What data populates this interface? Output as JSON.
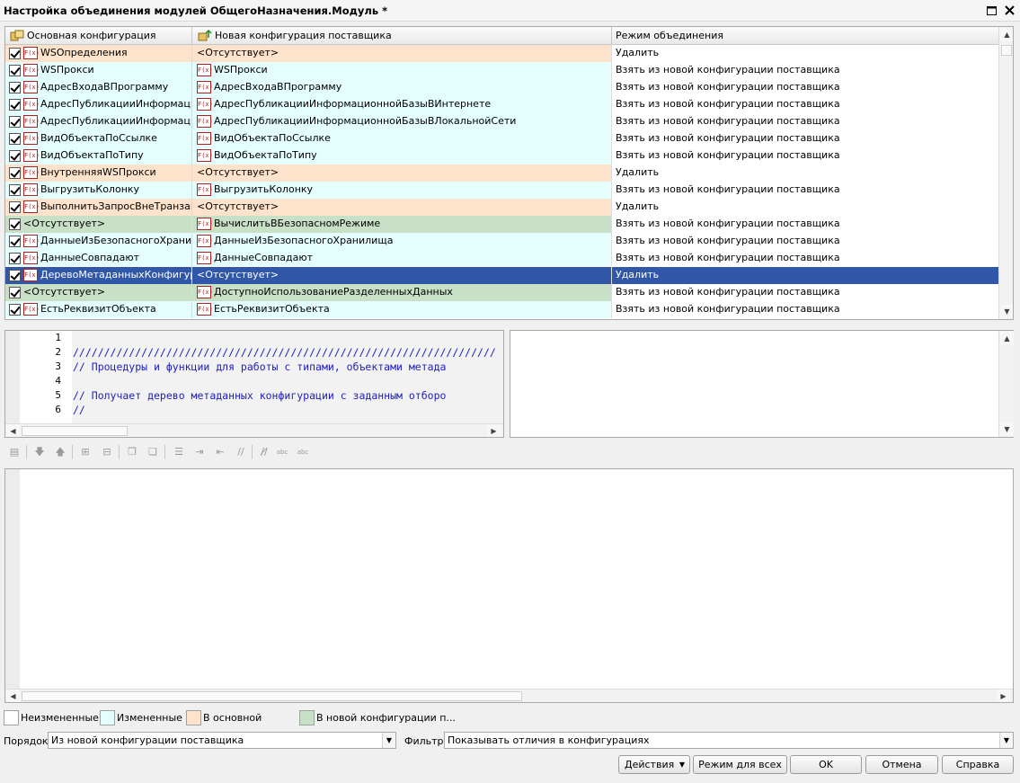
{
  "window": {
    "title": "Настройка объединения модулей ОбщегоНазначения.Модуль *"
  },
  "grid": {
    "columns": [
      "Основная конфигурация",
      "Новая конфигурация поставщика",
      "Режим объединения"
    ],
    "rows": [
      {
        "state": "inmain",
        "main": "WSОпределения",
        "main_icon": true,
        "vendor": "<Отсутствует>",
        "vendor_icon": false,
        "mode": "Удалить"
      },
      {
        "state": "changed",
        "main": "WSПрокси",
        "main_icon": true,
        "vendor": "WSПрокси",
        "vendor_icon": true,
        "mode": "Взять из новой конфигурации поставщика"
      },
      {
        "state": "changed",
        "main": "АдресВходаВПрограмму",
        "main_icon": true,
        "vendor": "АдресВходаВПрограмму",
        "vendor_icon": true,
        "mode": "Взять из новой конфигурации поставщика"
      },
      {
        "state": "changed",
        "main": "АдресПубликацииИнформаци...",
        "main_icon": true,
        "vendor": "АдресПубликацииИнформационнойБазыВИнтернете",
        "vendor_icon": true,
        "mode": "Взять из новой конфигурации поставщика"
      },
      {
        "state": "changed",
        "main": "АдресПубликацииИнформаци...",
        "main_icon": true,
        "vendor": "АдресПубликацииИнформационнойБазыВЛокальнойСети",
        "vendor_icon": true,
        "mode": "Взять из новой конфигурации поставщика"
      },
      {
        "state": "changed",
        "main": "ВидОбъектаПоСсылке",
        "main_icon": true,
        "vendor": "ВидОбъектаПоСсылке",
        "vendor_icon": true,
        "mode": "Взять из новой конфигурации поставщика"
      },
      {
        "state": "changed",
        "main": "ВидОбъектаПоТипу",
        "main_icon": true,
        "vendor": "ВидОбъектаПоТипу",
        "vendor_icon": true,
        "mode": "Взять из новой конфигурации поставщика"
      },
      {
        "state": "inmain",
        "main": "ВнутренняяWSПрокси",
        "main_icon": true,
        "vendor": "<Отсутствует>",
        "vendor_icon": false,
        "mode": "Удалить"
      },
      {
        "state": "changed",
        "main": "ВыгрузитьКолонку",
        "main_icon": true,
        "vendor": "ВыгрузитьКолонку",
        "vendor_icon": true,
        "mode": "Взять из новой конфигурации поставщика"
      },
      {
        "state": "inmain",
        "main": "ВыполнитьЗапросВнеТранзак...",
        "main_icon": true,
        "vendor": "<Отсутствует>",
        "vendor_icon": false,
        "mode": "Удалить"
      },
      {
        "state": "innew",
        "main": "<Отсутствует>",
        "main_icon": false,
        "vendor": "ВычислитьВБезопасномРежиме",
        "vendor_icon": true,
        "mode": "Взять из новой конфигурации поставщика"
      },
      {
        "state": "changed",
        "main": "ДанныеИзБезопасногоХрани...",
        "main_icon": true,
        "vendor": "ДанныеИзБезопасногоХранилища",
        "vendor_icon": true,
        "mode": "Взять из новой конфигурации поставщика"
      },
      {
        "state": "changed",
        "main": "ДанныеСовпадают",
        "main_icon": true,
        "vendor": "ДанныеСовпадают",
        "vendor_icon": true,
        "mode": "Взять из новой конфигурации поставщика"
      },
      {
        "state": "selected",
        "main": "ДеревоМетаданныхКонфигур...",
        "main_icon": true,
        "vendor": "<Отсутствует>",
        "vendor_icon": false,
        "mode": "Удалить"
      },
      {
        "state": "innew",
        "main": "<Отсутствует>",
        "main_icon": false,
        "vendor": "ДоступноИспользованиеРазделенныхДанных",
        "vendor_icon": true,
        "mode": "Взять из новой конфигурации поставщика"
      },
      {
        "state": "changed",
        "main": "ЕстьРеквизитОбъекта",
        "main_icon": true,
        "vendor": "ЕстьРеквизитОбъекта",
        "vendor_icon": true,
        "mode": "Взять из новой конфигурации поставщика"
      }
    ]
  },
  "code": {
    "line_numbers": [
      "1",
      "2",
      "3",
      "4",
      "5",
      "6"
    ],
    "lines": [
      "",
      "////////////////////////////////////////////////////////////////////",
      "// Процедуры и функции для работы с типами, объектами метада",
      "",
      "// Получает дерево метаданных конфигурации с заданным отборо",
      "//"
    ]
  },
  "legend": {
    "unchanged": "Неизмененные",
    "changed": "Измененные",
    "in_main": "В основной",
    "in_new": "В новой конфигурации п..."
  },
  "colors": {
    "unchanged": "#ffffff",
    "changed": "#e4fdfd",
    "in_main": "#fde3cc",
    "in_new": "#c8e0c6",
    "selected": "#3157a8"
  },
  "order": {
    "label": "Порядок:",
    "value": "Из новой конфигурации поставщика"
  },
  "filter": {
    "label": "Фильтр:",
    "value": "Показывать отличия в конфигурациях"
  },
  "buttons": {
    "actions": "Действия",
    "mode_all": "Режим для всех",
    "ok": "OK",
    "cancel": "Отмена",
    "help": "Справка"
  },
  "icons": {
    "module": "F(x)"
  }
}
